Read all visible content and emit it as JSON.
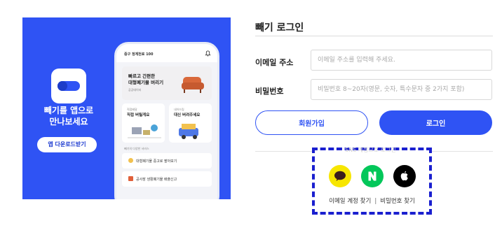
{
  "promo": {
    "headline_line1": "빼기를 앱으로",
    "headline_line2": "만나보세요",
    "download_label": "앱 다운로드받기",
    "phone": {
      "location": "중구 정계천로 100",
      "hero_title_line1": "빠르고 간편한",
      "hero_title_line2": "대형폐기물 버리기",
      "hero_chip": "공공데이터",
      "card1_label": "직접배달",
      "card1_title": "직접 버릴게요",
      "card2_label": "내어드림",
      "card2_title": "대신 버려주세요",
      "section_title": "빼기의 다양한 서비스",
      "service1": "대형폐기물 중고로 팔아보기",
      "service2": "공사장 생활폐기물 배출신고"
    }
  },
  "login": {
    "title": "빼기 로그인",
    "email_label": "이메일 주소",
    "email_placeholder": "이메일 주소를 입력해 주세요.",
    "password_label": "비밀번호",
    "password_placeholder": "비밀번호 8~20자(영문, 숫자, 특수문자 중 2가지 포함)",
    "signup_label": "회원가입",
    "login_label": "로그인",
    "social_caption": "SNS 계정으로 로그인",
    "find_email": "이메일 계정 찾기",
    "separator": "|",
    "find_password": "비밀번호 찾기"
  },
  "icons": {
    "kakao": "kakao-icon",
    "naver": "naver-icon",
    "apple": "apple-icon"
  },
  "colors": {
    "brand_blue": "#2f53f4",
    "kakao_yellow": "#f7e600",
    "naver_green": "#03c75a",
    "apple_black": "#000000",
    "highlight_border": "#1a1fcf"
  }
}
